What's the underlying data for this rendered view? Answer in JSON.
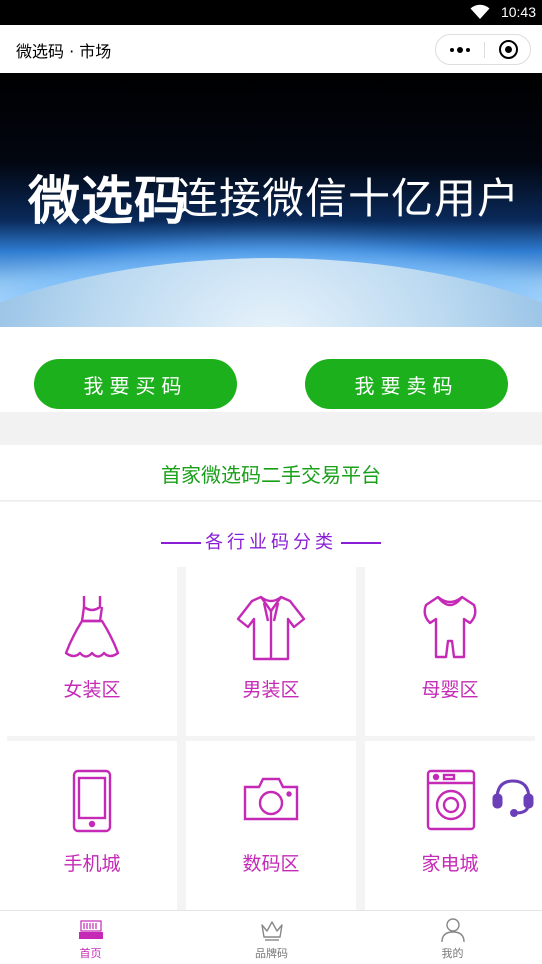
{
  "status_bar": {
    "time": "10:43"
  },
  "title_bar": {
    "title": "微选码 · 市场"
  },
  "banner": {
    "brand": "微选码",
    "slogan": "连接微信十亿用户"
  },
  "actions": {
    "buy_label": "我要买码",
    "sell_label": "我要卖码",
    "accent_color": "#1db01d"
  },
  "platform": {
    "text": "首家微选码二手交易平台"
  },
  "categories": {
    "title": "各行业码分类",
    "accent_color": "#c52ab7",
    "items": [
      {
        "label": "女装区",
        "icon": "dress-icon"
      },
      {
        "label": "男装区",
        "icon": "shirt-icon"
      },
      {
        "label": "母婴区",
        "icon": "baby-romper-icon"
      },
      {
        "label": "手机城",
        "icon": "phone-icon"
      },
      {
        "label": "数码区",
        "icon": "camera-icon"
      },
      {
        "label": "家电城",
        "icon": "washing-machine-icon"
      }
    ]
  },
  "support": {
    "icon": "headset-icon"
  },
  "tabbar": {
    "tabs": [
      {
        "label": "首页",
        "icon": "home-logo-icon",
        "active": true
      },
      {
        "label": "品牌码",
        "icon": "crown-icon",
        "active": false
      },
      {
        "label": "我的",
        "icon": "user-icon",
        "active": false
      }
    ]
  }
}
